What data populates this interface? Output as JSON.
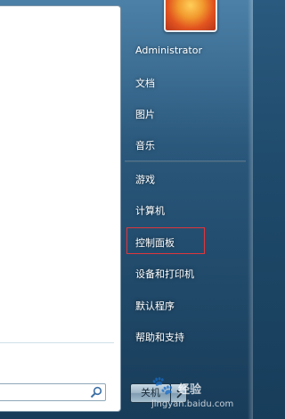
{
  "user": {
    "name": "Administrator"
  },
  "menu": {
    "items": [
      {
        "label": "文档"
      },
      {
        "label": "图片"
      },
      {
        "label": "音乐"
      },
      {
        "label": "游戏"
      },
      {
        "label": "计算机"
      },
      {
        "label": "控制面板"
      },
      {
        "label": "设备和打印机"
      },
      {
        "label": "默认程序"
      },
      {
        "label": "帮助和支持"
      }
    ]
  },
  "search": {
    "value": ""
  },
  "shutdown": {
    "label": "关机"
  },
  "watermark": {
    "brand": "经验",
    "url": "jingyan.baidu.com"
  },
  "icons": {
    "search": "search-icon",
    "shutdown_arrow": "chevron-right-icon",
    "avatar": "flower-avatar"
  },
  "colors": {
    "highlight": "#e0363c",
    "panel_top": "#69a0c8",
    "panel_bottom": "#173d5a"
  }
}
